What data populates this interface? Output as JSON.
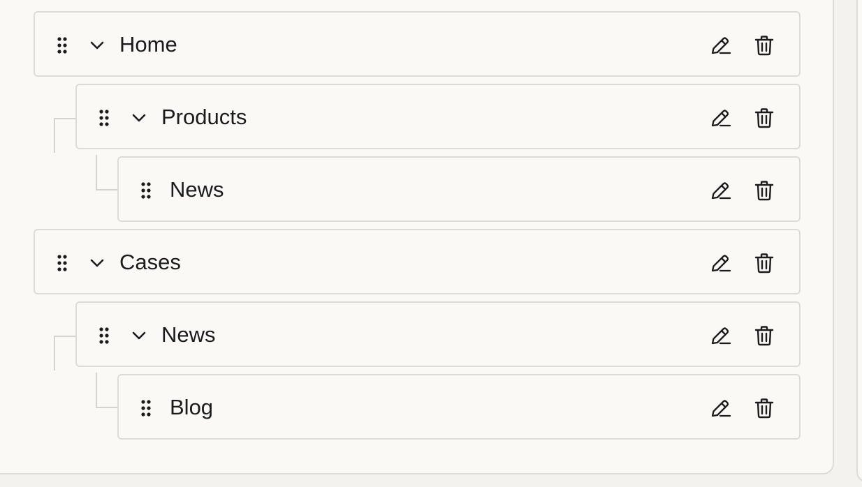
{
  "menu_tree": {
    "items": [
      {
        "label": "Home",
        "level": 0,
        "expanded": true
      },
      {
        "label": "Products",
        "level": 1,
        "expanded": true
      },
      {
        "label": "News",
        "level": 2,
        "expanded": null
      },
      {
        "label": "Cases",
        "level": 0,
        "expanded": true
      },
      {
        "label": "News",
        "level": 1,
        "expanded": true
      },
      {
        "label": "Blog",
        "level": 2,
        "expanded": null
      }
    ]
  },
  "icons": {
    "drag": "drag-handle-icon",
    "expand": "chevron-down-icon",
    "edit": "pencil-icon",
    "delete": "trash-icon"
  }
}
